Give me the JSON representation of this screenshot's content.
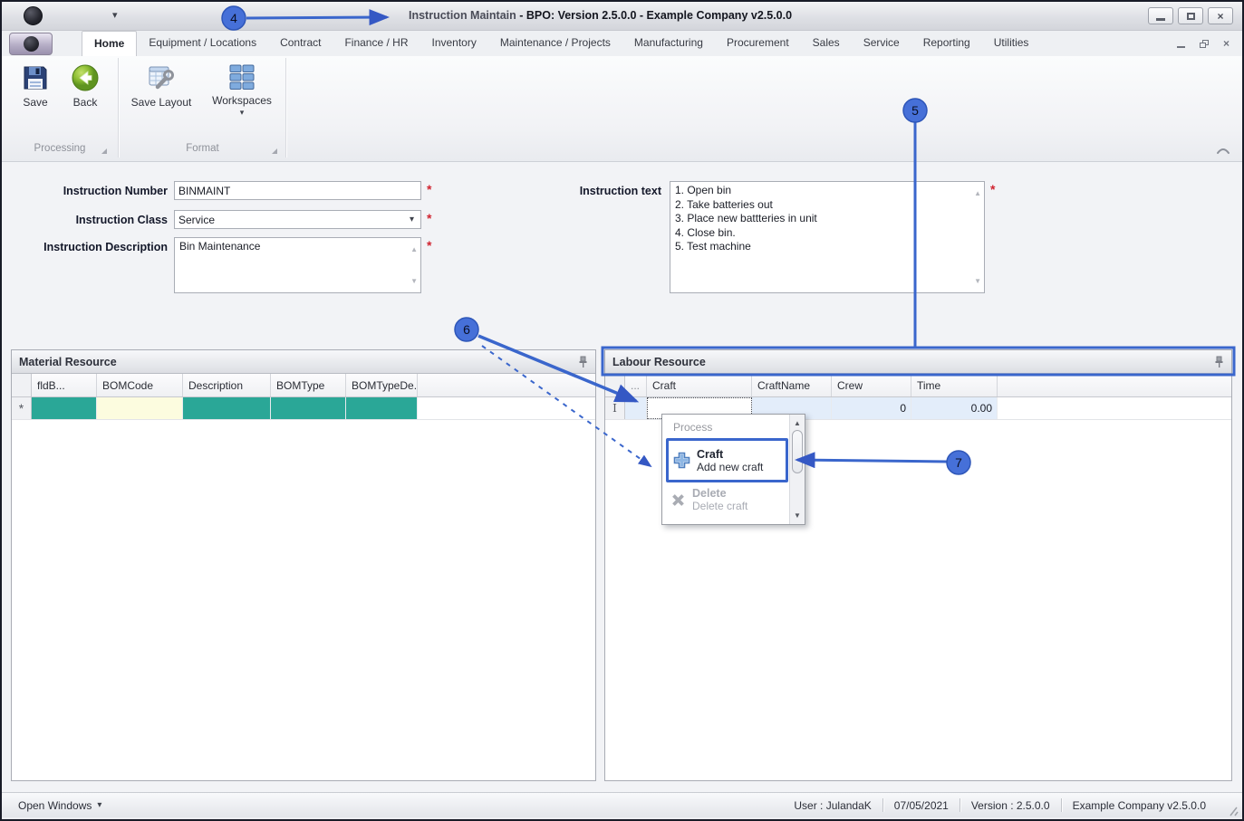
{
  "colors": {
    "annotation_accent": "#3A66CC",
    "callout_fill": "#4670D8",
    "teal_cell": "#2AA797",
    "cream_cell": "#FCFCDF",
    "row_selection_blue": "#E3EDFA",
    "required_red": "#D02430"
  },
  "titlebar": {
    "title_primary": "Instruction Maintain",
    "title_secondary": " - BPO: Version 2.5.0.0 - Example Company v2.5.0.0"
  },
  "ribbon": {
    "tabs": [
      "Home",
      "Equipment / Locations",
      "Contract",
      "Finance / HR",
      "Inventory",
      "Maintenance / Projects",
      "Manufacturing",
      "Procurement",
      "Sales",
      "Service",
      "Reporting",
      "Utilities"
    ],
    "save_label": "Save",
    "back_label": "Back",
    "save_layout_label": "Save Layout",
    "workspaces_label": "Workspaces",
    "group_processing": "Processing",
    "group_format": "Format"
  },
  "form": {
    "instruction_number_label": "Instruction Number",
    "instruction_number_value": "BINMAINT",
    "instruction_class_label": "Instruction Class",
    "instruction_class_value": "Service",
    "instruction_description_label": "Instruction Description",
    "instruction_description_value": "Bin Maintenance",
    "instruction_text_label": "Instruction text",
    "instruction_text_value": "1. Open bin\n2. Take batteries out\n3. Place new battteries in unit\n4. Close bin.\n5. Test machine",
    "required_marker": "*"
  },
  "material_grid": {
    "title": "Material Resource",
    "columns": [
      "fldB...",
      "BOMCode",
      "Description",
      "BOMType",
      "BOMTypeDe..."
    ],
    "new_row_indicator": "*"
  },
  "labour_grid": {
    "title": "Labour Resource",
    "columns": [
      "...",
      "Craft",
      "CraftName",
      "Crew",
      "Time"
    ],
    "row": {
      "indicator": "I",
      "crew": "0",
      "time": "0.00"
    }
  },
  "context_menu": {
    "header": "Process",
    "craft_title": "Craft",
    "craft_subtitle": "Add new craft",
    "delete_title": "Delete",
    "delete_subtitle": "Delete craft"
  },
  "statusbar": {
    "open_windows": "Open Windows",
    "user": "User : JulandaK",
    "date": "07/05/2021",
    "version": "Version : 2.5.0.0",
    "company": "Example Company v2.5.0.0"
  },
  "callouts": {
    "c4": "4",
    "c5": "5",
    "c6": "6",
    "c7": "7"
  },
  "icons": {
    "dropdown_caret": "▾",
    "scroll_up": "▲",
    "scroll_down": "▼",
    "close_glyph": "×"
  }
}
